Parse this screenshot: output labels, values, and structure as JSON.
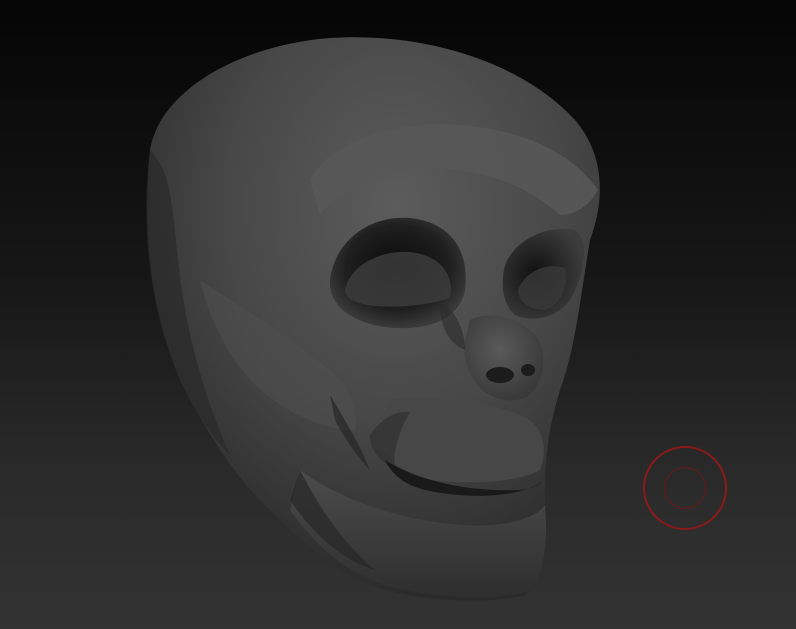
{
  "canvas": {
    "background_top": "#050505",
    "background_bottom": "#333333",
    "model_color": "#4a4a4a"
  },
  "model": {
    "icon": "alien-skull-sculpt-icon"
  },
  "brush": {
    "icon": "brush-cursor-icon",
    "color": "#8a1a1a"
  }
}
